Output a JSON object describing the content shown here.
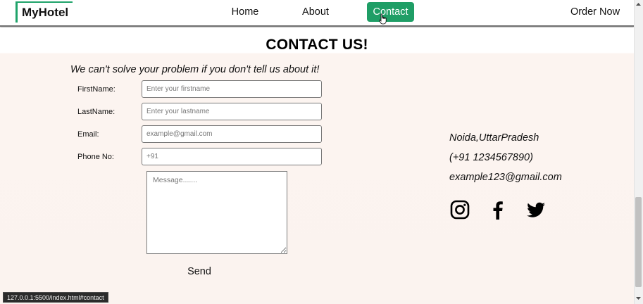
{
  "navbar": {
    "logo": "MyHotel",
    "links": [
      {
        "label": "Home"
      },
      {
        "label": "About"
      },
      {
        "label": "Contact",
        "active": true
      },
      {
        "label": "Order Now"
      }
    ],
    "active_color": "#1f9e66"
  },
  "contact": {
    "title": "CONTACT US!",
    "tagline": "We can't solve your problem if you don't tell us about it!",
    "fields": [
      {
        "label": "FirstName:",
        "placeholder": "Enter your firstname",
        "value": ""
      },
      {
        "label": "LastName:",
        "placeholder": "Enter your lastname",
        "value": ""
      },
      {
        "label": "Email:",
        "placeholder": "example@gmail.com",
        "value": ""
      },
      {
        "label": "Phone No:",
        "placeholder": "+91",
        "value": ""
      }
    ],
    "message_placeholder": "Message.......",
    "send_label": "Send"
  },
  "info": {
    "location": "Noida,UttarPradesh",
    "phone": "(+91 1234567890)",
    "email": "example123@gmail.com",
    "social": [
      "instagram-icon",
      "facebook-icon",
      "twitter-icon"
    ]
  },
  "statusbar": {
    "url": "127.0.0.1:5500/index.html#contact"
  }
}
